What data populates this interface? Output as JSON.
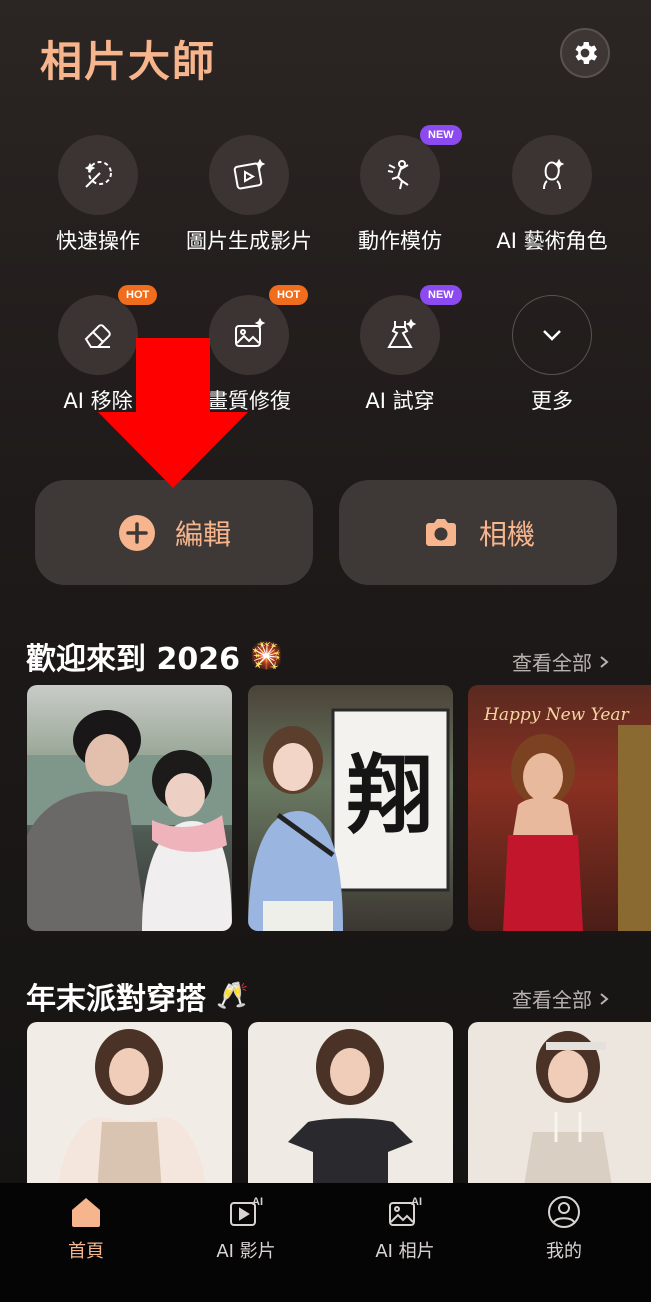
{
  "header": {
    "title": "相片大師",
    "settings_icon": "gear-icon"
  },
  "tools": [
    {
      "label": "快速操作",
      "icon": "magic-wand-icon",
      "badge": ""
    },
    {
      "label": "圖片生成影片",
      "icon": "image-to-video-icon",
      "badge": ""
    },
    {
      "label": "動作模仿",
      "icon": "dance-figure-icon",
      "badge": "NEW"
    },
    {
      "label": "AI 藝術角色",
      "icon": "portrait-sparkle-icon",
      "badge": ""
    },
    {
      "label": "AI 移除",
      "icon": "eraser-icon",
      "badge": "HOT"
    },
    {
      "label": "畫質修復",
      "icon": "image-enhance-icon",
      "badge": "HOT"
    },
    {
      "label": "AI 試穿",
      "icon": "dress-icon",
      "badge": "NEW"
    },
    {
      "label": "更多",
      "icon": "chevron-down-icon",
      "badge": ""
    }
  ],
  "actions": {
    "edit_label": "編輯",
    "camera_label": "相機"
  },
  "sections": [
    {
      "title": "歡迎來到 2026",
      "emoji": "🎇",
      "see_all": "查看全部"
    },
    {
      "title": "年末派對穿搭",
      "emoji": "🥂",
      "see_all": "查看全部"
    }
  ],
  "thumbnails_row1": [
    {
      "caption": ""
    },
    {
      "caption": "翔"
    },
    {
      "caption": "Happy New Year"
    }
  ],
  "tabbar": [
    {
      "label": "首頁",
      "icon": "home-icon",
      "active": true
    },
    {
      "label": "AI 影片",
      "icon": "ai-video-icon",
      "active": false
    },
    {
      "label": "AI 相片",
      "icon": "ai-photo-icon",
      "active": false
    },
    {
      "label": "我的",
      "icon": "profile-icon",
      "active": false
    }
  ],
  "colors": {
    "accent": "#f6b58d",
    "new_badge": "#8c4bf0",
    "hot_badge": "#f06d1e",
    "arrow": "#ff0000"
  }
}
